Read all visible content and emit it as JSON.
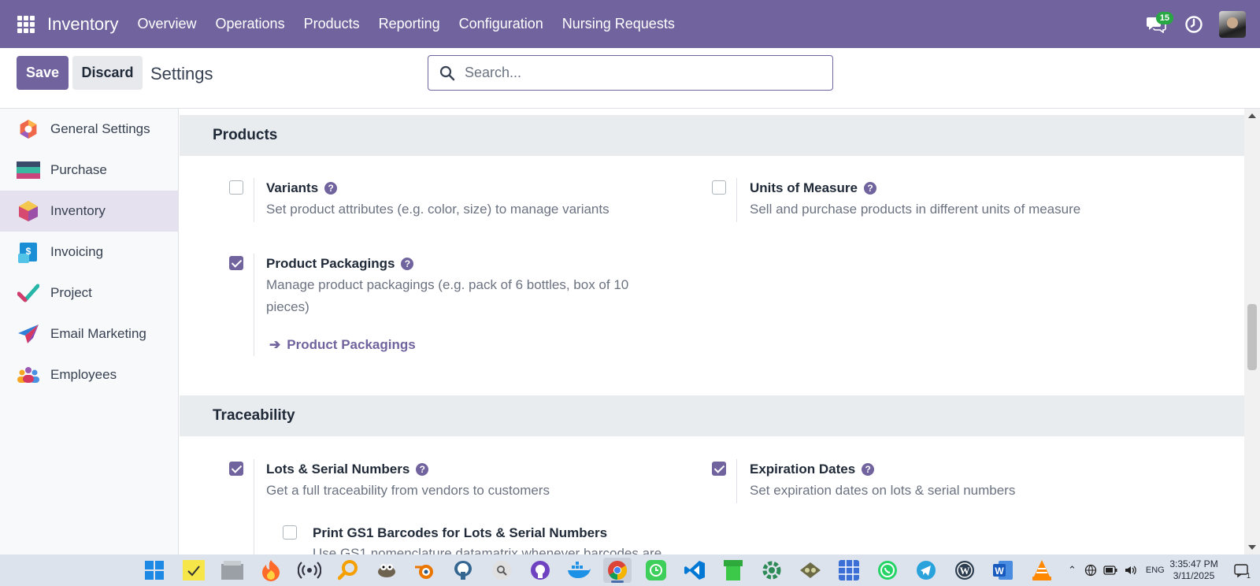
{
  "topbar": {
    "app_name": "Inventory",
    "menu": [
      "Overview",
      "Operations",
      "Products",
      "Reporting",
      "Configuration",
      "Nursing Requests"
    ],
    "message_count": "15"
  },
  "control_panel": {
    "save_label": "Save",
    "discard_label": "Discard",
    "title": "Settings",
    "search_placeholder": "Search..."
  },
  "sidebar": {
    "items": [
      {
        "label": "General Settings",
        "icon": "general-settings-icon"
      },
      {
        "label": "Purchase",
        "icon": "purchase-icon"
      },
      {
        "label": "Inventory",
        "icon": "inventory-icon",
        "active": true
      },
      {
        "label": "Invoicing",
        "icon": "invoicing-icon"
      },
      {
        "label": "Project",
        "icon": "project-icon"
      },
      {
        "label": "Email Marketing",
        "icon": "email-marketing-icon"
      },
      {
        "label": "Employees",
        "icon": "employees-icon"
      }
    ]
  },
  "sections": {
    "products": {
      "title": "Products",
      "variants": {
        "title": "Variants",
        "desc": "Set product attributes (e.g. color, size) to manage variants",
        "checked": false
      },
      "uom": {
        "title": "Units of Measure",
        "desc": "Sell and purchase products in different units of measure",
        "checked": false
      },
      "packagings": {
        "title": "Product Packagings",
        "desc": "Manage product packagings (e.g. pack of 6 bottles, box of 10 pieces)",
        "checked": true,
        "link": "Product Packagings"
      }
    },
    "traceability": {
      "title": "Traceability",
      "lots": {
        "title": "Lots & Serial Numbers",
        "desc": "Get a full traceability from vendors to customers",
        "checked": true
      },
      "expiration": {
        "title": "Expiration Dates",
        "desc": "Set expiration dates on lots & serial numbers",
        "checked": true
      },
      "gs1": {
        "title": "Print GS1 Barcodes for Lots & Serial Numbers",
        "desc": "Use GS1 nomenclature datamatrix whenever barcodes are",
        "checked": false
      }
    }
  },
  "taskbar": {
    "apps": [
      "windows-start-icon",
      "sticky-notes-icon",
      "file-manager-icon",
      "firefox-icon",
      "wifi-analyzer-icon",
      "search-tool-icon",
      "gimp-icon",
      "blender-icon",
      "postgresql-icon",
      "magnifier-icon",
      "github-icon",
      "docker-icon",
      "chrome-icon",
      "clock-app-icon",
      "vscode-icon",
      "green-pipe-icon",
      "gear-app-icon",
      "wine-icon",
      "grid-app-icon",
      "whatsapp-icon",
      "telegram-icon",
      "wordpress-icon",
      "word-icon",
      "vlc-icon"
    ],
    "language": "ENG",
    "time": "3:35:47 PM",
    "date": "3/11/2025",
    "notification_count": "1"
  },
  "colors": {
    "brand": "#71639e",
    "topbar": "#71639e",
    "checkbox": "#71639e"
  }
}
